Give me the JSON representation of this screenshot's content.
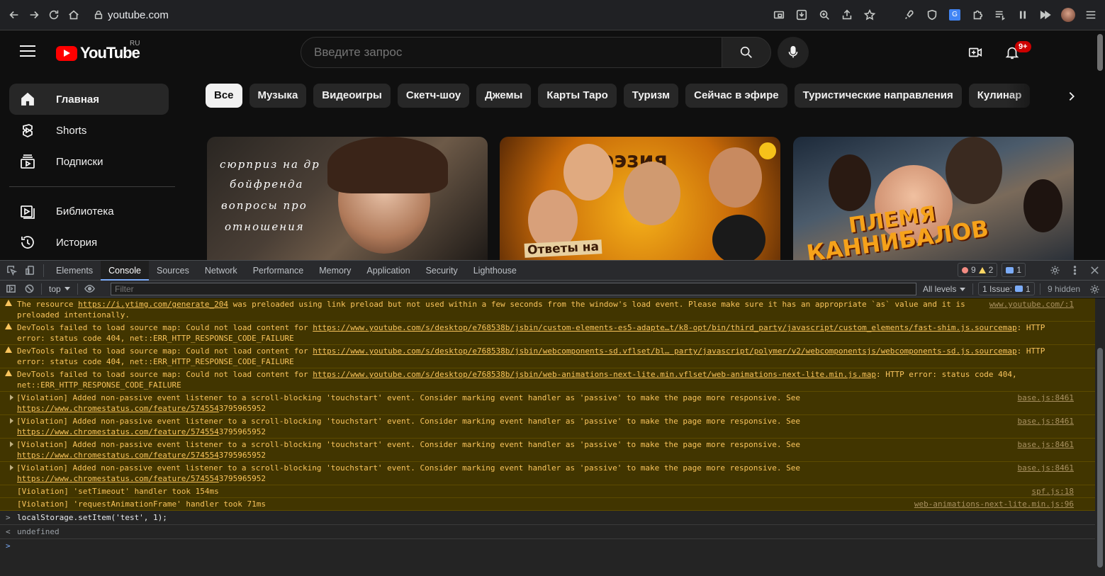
{
  "browser": {
    "url": "youtube.com"
  },
  "youtube": {
    "logo": "YouTube",
    "region": "RU",
    "search_placeholder": "Введите запрос",
    "notification_count": "9+",
    "sidebar": [
      {
        "label": "Главная"
      },
      {
        "label": "Shorts"
      },
      {
        "label": "Подписки"
      },
      {
        "label": "Библиотека"
      },
      {
        "label": "История"
      }
    ],
    "chips": [
      "Все",
      "Музыка",
      "Видеоигры",
      "Скетч-шоу",
      "Джемы",
      "Карты Таро",
      "Туризм",
      "Сейчас в эфире",
      "Туристические направления",
      "Кулинар"
    ],
    "thumbnails": [
      {
        "text_lines": [
          "сюрприз на др",
          "бойфренда",
          "вопросы про",
          "отношения"
        ]
      },
      {
        "title": "поэзия",
        "subtitle": "Ответы на"
      },
      {
        "title": "ПЛЕМЯ",
        "subtitle": "КАННИБАЛОВ"
      }
    ]
  },
  "devtools": {
    "tabs": [
      "Elements",
      "Console",
      "Sources",
      "Network",
      "Performance",
      "Memory",
      "Application",
      "Security",
      "Lighthouse"
    ],
    "active_tab": "Console",
    "errors": "9",
    "warnings": "2",
    "info": "1",
    "context": "top",
    "filter_placeholder": "Filter",
    "levels": "All levels",
    "issues_label": "1 Issue:",
    "issues_count": "1",
    "hidden": "9 hidden",
    "messages": [
      {
        "type": "warn",
        "pre": "The resource ",
        "link": "https://i.ytimg.com/generate_204",
        "post": " was preloaded using link preload but not used within a few seconds from the window's load event. Please make sure it has an appropriate `as` value and it is preloaded intentionally.",
        "source": "www.youtube.com/:1"
      },
      {
        "type": "warn",
        "pre": "DevTools failed to load source map: Could not load content for ",
        "link": "https://www.youtube.com/s/desktop/e768538b/jsbin/custom-elements-es5-adapte…t/k8-opt/bin/third_party/javascript/custom_elements/fast-shim.js.sourcemap",
        "post": ": HTTP error: status code 404, net::ERR_HTTP_RESPONSE_CODE_FAILURE",
        "source": ""
      },
      {
        "type": "warn",
        "pre": "DevTools failed to load source map: Could not load content for ",
        "link": "https://www.youtube.com/s/desktop/e768538b/jsbin/webcomponents-sd.vflset/bl… party/javascript/polymer/v2/webcomponentsjs/webcomponents-sd.js.sourcemap",
        "post": ": HTTP error: status code 404, net::ERR_HTTP_RESPONSE_CODE_FAILURE",
        "source": ""
      },
      {
        "type": "warn",
        "pre": "DevTools failed to load source map: Could not load content for ",
        "link": "https://www.youtube.com/s/desktop/e768538b/jsbin/web-animations-next-lite.min.vflset/web-animations-next-lite.min.js.map",
        "post": ": HTTP error: status code 404, net::ERR_HTTP_RESPONSE_CODE_FAILURE",
        "source": ""
      },
      {
        "type": "violation",
        "pre": "[Violation] Added non-passive event listener to a scroll-blocking 'touchstart' event. Consider marking event handler as 'passive' to make the page more responsive. See ",
        "link": "https://www.chromestatus.com/feature/574554",
        "post": "3795965952",
        "source": "base.js:8461"
      },
      {
        "type": "violation",
        "pre": "[Violation] Added non-passive event listener to a scroll-blocking 'touchstart' event. Consider marking event handler as 'passive' to make the page more responsive. See ",
        "link": "https://www.chromestatus.com/feature/574554",
        "post": "3795965952",
        "source": "base.js:8461"
      },
      {
        "type": "violation",
        "pre": "[Violation] Added non-passive event listener to a scroll-blocking 'touchstart' event. Consider marking event handler as 'passive' to make the page more responsive. See ",
        "link": "https://www.chromestatus.com/feature/574554",
        "post": "3795965952",
        "source": "base.js:8461"
      },
      {
        "type": "violation",
        "pre": "[Violation] Added non-passive event listener to a scroll-blocking 'touchstart' event. Consider marking event handler as 'passive' to make the page more responsive. See ",
        "link": "https://www.chromestatus.com/feature/574554",
        "post": "3795965952",
        "source": "base.js:8461"
      },
      {
        "type": "simple",
        "pre": "[Violation] 'setTimeout' handler took 154ms",
        "link": "",
        "post": "",
        "source": "spf.js:18"
      },
      {
        "type": "simple",
        "pre": "[Violation] 'requestAnimationFrame' handler took 71ms",
        "link": "",
        "post": "",
        "source": "web-animations-next-lite.min.js:96"
      }
    ],
    "input_command": "localStorage.setItem('test', 1);",
    "output_value": "undefined"
  }
}
